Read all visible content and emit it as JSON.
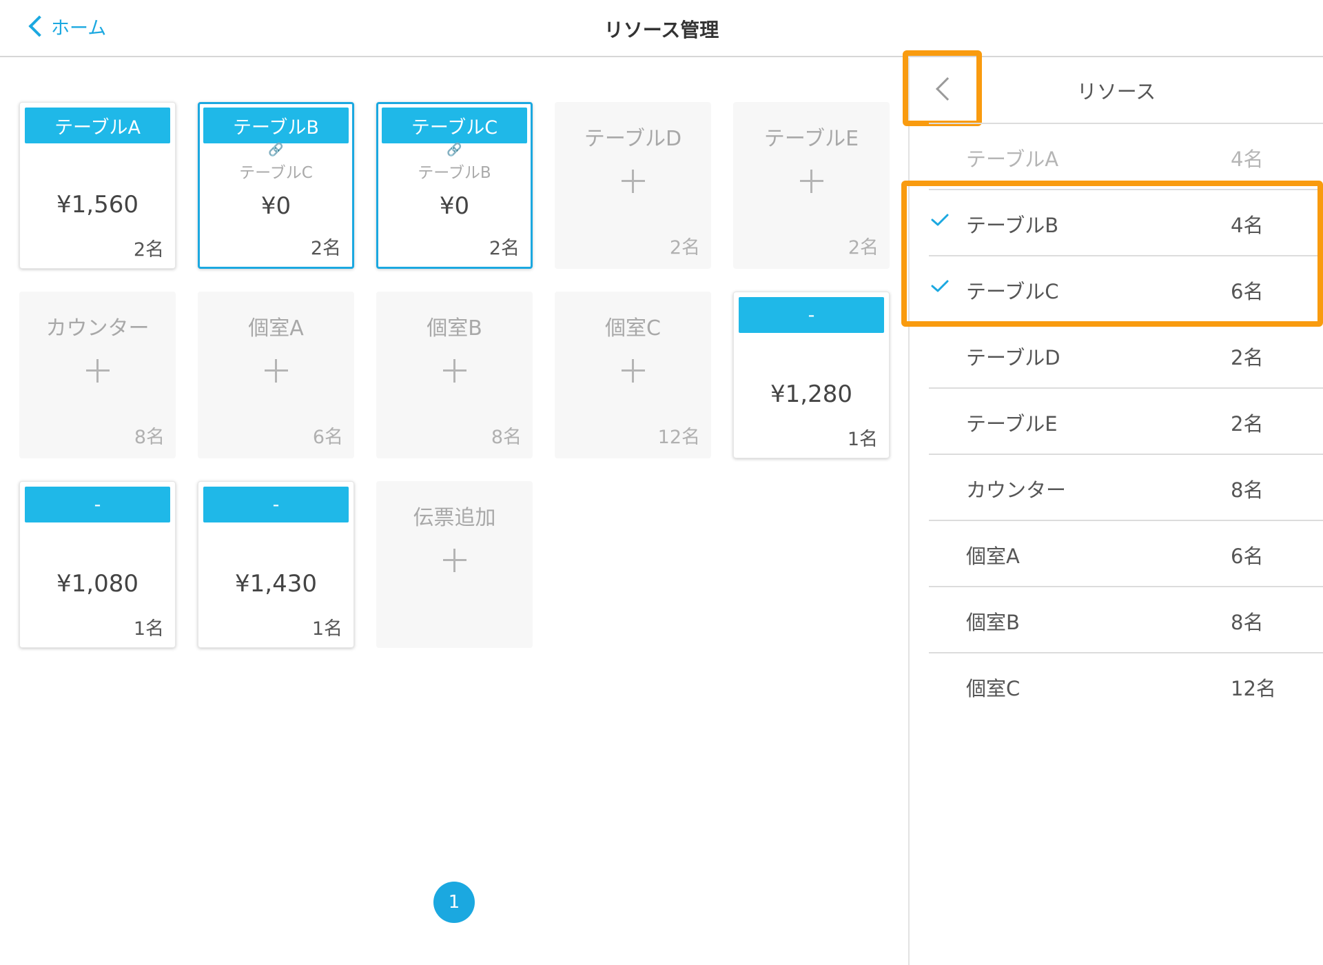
{
  "header": {
    "back_label": "ホーム",
    "title": "リソース管理"
  },
  "cards": [
    {
      "type": "active",
      "selected": false,
      "label": "テーブルA",
      "amount": "¥1,560",
      "guests": "2名"
    },
    {
      "type": "active",
      "selected": true,
      "label": "テーブルB",
      "linked": "テーブルC",
      "amount": "¥0",
      "guests": "2名"
    },
    {
      "type": "active",
      "selected": true,
      "label": "テーブルC",
      "linked": "テーブルB",
      "amount": "¥0",
      "guests": "2名"
    },
    {
      "type": "empty",
      "label": "テーブルD",
      "guests": "2名"
    },
    {
      "type": "empty",
      "label": "テーブルE",
      "guests": "2名"
    },
    {
      "type": "empty",
      "label": "カウンター",
      "guests": "8名"
    },
    {
      "type": "empty",
      "label": "個室A",
      "guests": "6名"
    },
    {
      "type": "empty",
      "label": "個室B",
      "guests": "8名"
    },
    {
      "type": "empty",
      "label": "個室C",
      "guests": "12名"
    },
    {
      "type": "active",
      "selected": false,
      "label": "-",
      "amount": "¥1,280",
      "guests": "1名"
    },
    {
      "type": "active",
      "selected": false,
      "label": "-",
      "amount": "¥1,080",
      "guests": "1名"
    },
    {
      "type": "active",
      "selected": false,
      "label": "-",
      "amount": "¥1,430",
      "guests": "1名"
    },
    {
      "type": "empty",
      "label": "伝票追加",
      "guests": ""
    }
  ],
  "pagination": {
    "current": "1"
  },
  "panel": {
    "title": "リソース",
    "items": [
      {
        "name": "テーブルA",
        "count": "4名",
        "checked": false,
        "disabled": true
      },
      {
        "name": "テーブルB",
        "count": "4名",
        "checked": true,
        "disabled": false
      },
      {
        "name": "テーブルC",
        "count": "6名",
        "checked": true,
        "disabled": false
      },
      {
        "name": "テーブルD",
        "count": "2名",
        "checked": false,
        "disabled": false
      },
      {
        "name": "テーブルE",
        "count": "2名",
        "checked": false,
        "disabled": false
      },
      {
        "name": "カウンター",
        "count": "8名",
        "checked": false,
        "disabled": false
      },
      {
        "name": "個室A",
        "count": "6名",
        "checked": false,
        "disabled": false
      },
      {
        "name": "個室B",
        "count": "8名",
        "checked": false,
        "disabled": false
      },
      {
        "name": "個室C",
        "count": "12名",
        "checked": false,
        "disabled": false
      }
    ]
  },
  "colors": {
    "accent": "#1ba8e0",
    "header_fill": "#1fb8e8",
    "highlight": "#f99b0f"
  }
}
